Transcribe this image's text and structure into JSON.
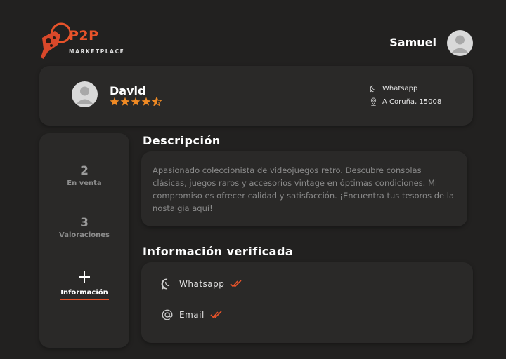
{
  "brand": {
    "name": "P2P",
    "tagline": "MARKETPLACE",
    "accent": "#e8532a"
  },
  "header": {
    "user_name": "Samuel"
  },
  "seller": {
    "name": "David",
    "rating": 4.5,
    "contacts": [
      {
        "icon": "whatsapp-icon",
        "text": "Whatsapp"
      },
      {
        "icon": "location-pin-icon",
        "text": "A Coruña, 15008"
      }
    ]
  },
  "sidebar": {
    "stats": [
      {
        "value": "2",
        "label": "En venta"
      },
      {
        "value": "3",
        "label": "Valoraciones"
      }
    ],
    "info_tab": {
      "icon": "plus-icon",
      "label": "Información"
    }
  },
  "description": {
    "title": "Descripción",
    "text": "Apasionado coleccionista de videojuegos retro. Descubre consolas clásicas, juegos raros y accesorios vintage en óptimas condiciones. Mi compromiso es ofrecer calidad y satisfacción. ¡Encuentra tus tesoros de la nostalgia aquí!"
  },
  "verified": {
    "title": "Información verificada",
    "items": [
      {
        "icon": "whatsapp-icon",
        "label": "Whatsapp",
        "status_icon": "double-check-icon"
      },
      {
        "icon": "at-sign-icon",
        "label": "Email",
        "status_icon": "double-check-icon"
      }
    ]
  }
}
